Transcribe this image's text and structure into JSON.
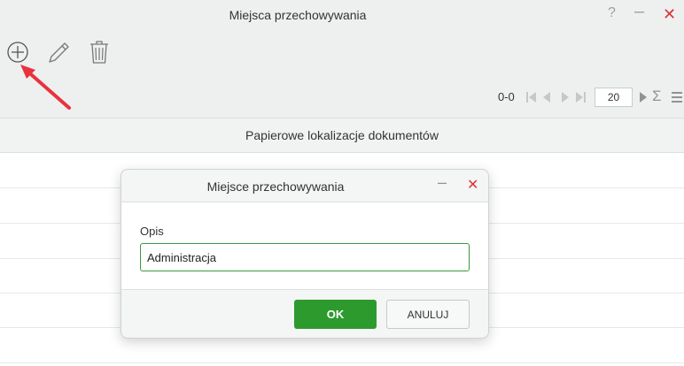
{
  "window": {
    "title": "Miejsca przechowywania",
    "help_glyph": "?",
    "minimize_glyph": "–",
    "close_glyph": "✕"
  },
  "toolbar": {
    "add_icon": "circle-plus-icon",
    "edit_icon": "pencil-icon",
    "delete_icon": "trash-icon"
  },
  "annotation": {
    "arrow_color": "#e8333f"
  },
  "pager": {
    "range": "0-0",
    "page_size": "20",
    "sum_glyph": "Σ"
  },
  "grid": {
    "column_header": "Papierowe lokalizacje dokumentów"
  },
  "dialog": {
    "title": "Miejsce przechowywania",
    "minimize_glyph": "–",
    "close_glyph": "✕",
    "field_label": "Opis",
    "field_value": "Administracja",
    "ok_label": "OK",
    "cancel_label": "ANULUJ"
  },
  "colors": {
    "accent_green": "#2d9a2d",
    "close_red": "#d9343b"
  }
}
